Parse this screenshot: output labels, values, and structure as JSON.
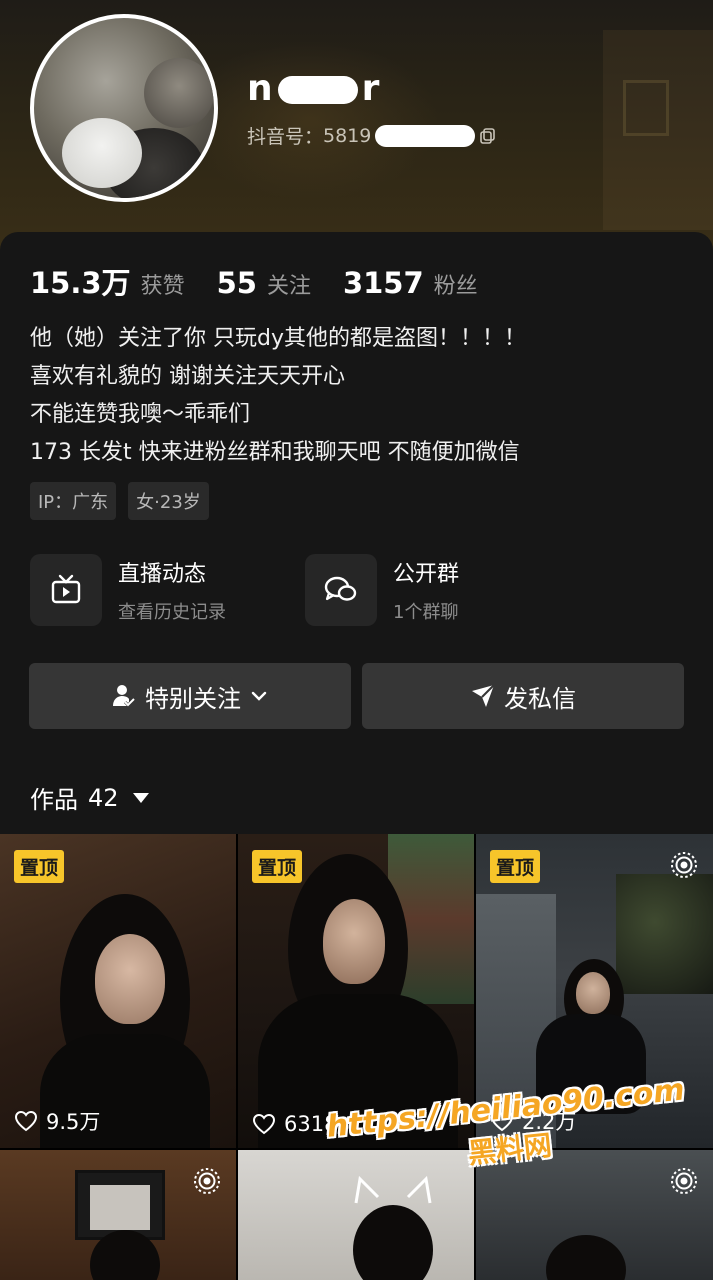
{
  "profile": {
    "name_start": "n",
    "name_end": "r",
    "douyin_id_label": "抖音号：",
    "douyin_id_value": "5819"
  },
  "stats": [
    {
      "value": "15.3万",
      "label": "获赞"
    },
    {
      "value": "55",
      "label": "关注"
    },
    {
      "value": "3157",
      "label": "粉丝"
    }
  ],
  "bio": [
    "他（她）关注了你 只玩dy其他的都是盗图！！！！",
    "喜欢有礼貌的 谢谢关注天天开心",
    "不能连赞我噢～乖乖们",
    "173 长发t  快来进粉丝群和我聊天吧 不随便加微信"
  ],
  "tags": {
    "ip": "IP：广东",
    "gender_age": "女·23岁"
  },
  "features": {
    "live": {
      "title": "直播动态",
      "subtitle": "查看历史记录",
      "icon": "tv-icon"
    },
    "group": {
      "title": "公开群",
      "subtitle": "1个群聊",
      "icon": "chat-bubbles-icon"
    }
  },
  "buttons": {
    "follow": "特别关注",
    "message": "发私信"
  },
  "works": {
    "label": "作品",
    "count": "42"
  },
  "videos": [
    {
      "pinned": "置顶",
      "likes": "9.5万"
    },
    {
      "pinned": "置顶",
      "likes": "6318"
    },
    {
      "pinned": "置顶",
      "likes": "2.2万"
    },
    {},
    {},
    {}
  ],
  "watermark": {
    "url": "https://heiliao90.com",
    "name": "黑料网"
  },
  "colors": {
    "pin_badge": "#f7c52a",
    "background": "#161616",
    "button": "#363636",
    "watermark": "#f5a623"
  }
}
